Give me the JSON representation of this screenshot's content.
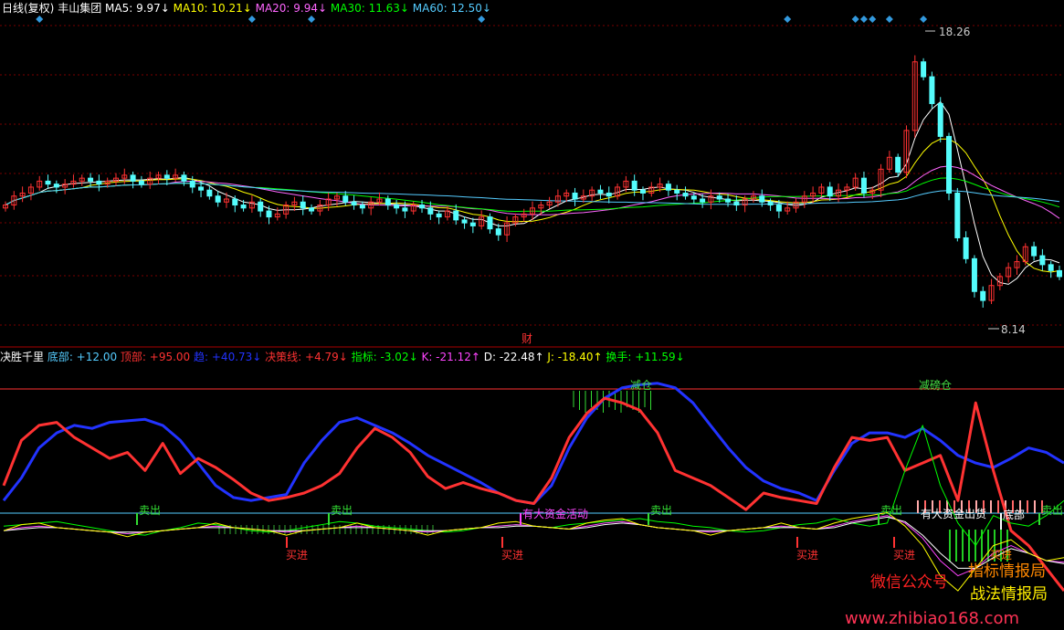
{
  "header_top": {
    "period_label": "日线(复权)",
    "stock_name": "丰山集团",
    "ma": [
      {
        "label": "MA5:",
        "value": "9.97",
        "arrow": "↓",
        "color": "#ffffff"
      },
      {
        "label": "MA10:",
        "value": "10.21",
        "arrow": "↓",
        "color": "#ffff00"
      },
      {
        "label": "MA20:",
        "value": "9.94",
        "arrow": "↓",
        "color": "#ff66ff"
      },
      {
        "label": "MA30:",
        "value": "11.63",
        "arrow": "↓",
        "color": "#00ff00"
      },
      {
        "label": "MA60:",
        "value": "12.50",
        "arrow": "↓",
        "color": "#55ccff"
      }
    ]
  },
  "price_panel": {
    "high_label": "18.26",
    "low_label": "8.14",
    "finance_marker": "财",
    "colors": {
      "up": "#ff3232",
      "down": "#54fcfc",
      "grid": "#7a0000"
    }
  },
  "header_bottom": {
    "indicator_name": "决胜千里",
    "items": [
      {
        "label": "底部:",
        "value": "+12.00",
        "arrow": "",
        "color": "#55ccff"
      },
      {
        "label": "顶部:",
        "value": "+95.00",
        "arrow": "",
        "color": "#ff3232"
      },
      {
        "label": "趋:",
        "value": "+40.73",
        "arrow": "↓",
        "color": "#2233ff"
      },
      {
        "label": "决策线:",
        "value": "+4.79",
        "arrow": "↓",
        "color": "#ff3232"
      },
      {
        "label": "指标:",
        "value": "-3.02",
        "arrow": "↓",
        "color": "#00ff00"
      },
      {
        "label": "K:",
        "value": "-21.12",
        "arrow": "↑",
        "color": "#ff44ff"
      },
      {
        "label": "D:",
        "value": "-22.48",
        "arrow": "↑",
        "color": "#ffffff"
      },
      {
        "label": "J:",
        "value": "-18.40",
        "arrow": "↑",
        "color": "#ffff00"
      },
      {
        "label": "换手:",
        "value": "+11.59",
        "arrow": "↓",
        "color": "#00ff00"
      }
    ]
  },
  "indicator_annotations": {
    "sell": "卖出",
    "buy": "买进",
    "reduce": "减仓",
    "reduce2": "减磅仓",
    "funds_active": "有大资金活动",
    "inflow": "有大资金出货",
    "bottom": "底部",
    "buy_cn": "买进"
  },
  "watermark": {
    "wechat": "微信公众号",
    "name1": "指标情报局",
    "name2": "战法情报局",
    "url": "www.zhibiao168.com"
  },
  "chart_data": [
    {
      "type": "candlestick",
      "title": "丰山集团 日线(复权)",
      "ylim": [
        8,
        18.5
      ],
      "max_price": 18.26,
      "min_price": 8.14,
      "ma_last": {
        "MA5": 9.97,
        "MA10": 10.21,
        "MA20": 9.94,
        "MA30": 11.63,
        "MA60": 12.5
      },
      "close_series": [
        12.3,
        12.6,
        12.7,
        12.9,
        13.1,
        13.0,
        12.9,
        13.0,
        13.1,
        13.2,
        13.1,
        13.0,
        13.1,
        13.2,
        13.3,
        13.1,
        13.0,
        13.2,
        13.3,
        13.2,
        13.3,
        13.1,
        12.9,
        12.8,
        12.6,
        12.4,
        12.5,
        12.3,
        12.2,
        12.4,
        12.1,
        11.9,
        12.0,
        12.3,
        12.4,
        12.2,
        12.1,
        12.3,
        12.5,
        12.6,
        12.4,
        12.3,
        12.2,
        12.4,
        12.5,
        12.3,
        12.2,
        12.1,
        12.3,
        12.2,
        12.0,
        11.9,
        12.1,
        11.8,
        11.7,
        11.6,
        11.9,
        11.5,
        11.3,
        11.7,
        11.9,
        12.0,
        12.2,
        12.3,
        12.4,
        12.6,
        12.7,
        12.5,
        12.6,
        12.8,
        12.7,
        12.6,
        12.9,
        13.1,
        12.8,
        12.7,
        12.9,
        13.0,
        12.8,
        12.7,
        12.6,
        12.5,
        12.4,
        12.6,
        12.5,
        12.4,
        12.3,
        12.5,
        12.6,
        12.4,
        12.3,
        12.1,
        12.2,
        12.4,
        12.6,
        12.7,
        12.9,
        12.6,
        12.8,
        12.9,
        13.2,
        12.7,
        12.8,
        13.5,
        13.9,
        13.4,
        14.8,
        17.1,
        16.6,
        15.7,
        14.6,
        12.7,
        11.2,
        10.5,
        9.4,
        9.1,
        9.6,
        9.9,
        10.2,
        10.4,
        10.9,
        10.6,
        10.3,
        10.1,
        9.9
      ],
      "buy_signal_marks": [
        4,
        29,
        36,
        56,
        92,
        100,
        101,
        102,
        104,
        108
      ]
    },
    {
      "type": "line",
      "title": "决胜千里",
      "ylim": [
        -60,
        110
      ],
      "bottom_line": 12,
      "top_line": 95,
      "series": [
        {
          "name": "趋",
          "color": "#2233ff",
          "values": [
            20,
            35,
            55,
            65,
            70,
            68,
            72,
            73,
            74,
            70,
            60,
            45,
            30,
            22,
            20,
            22,
            24,
            45,
            60,
            72,
            75,
            70,
            65,
            58,
            50,
            44,
            38,
            32,
            25,
            20,
            18,
            30,
            55,
            75,
            88,
            95,
            97,
            98,
            95,
            85,
            70,
            55,
            42,
            33,
            28,
            25,
            20,
            40,
            58,
            65,
            65,
            62,
            68,
            60,
            50,
            45,
            42,
            48,
            55,
            52,
            45
          ]
        },
        {
          "name": "决策线",
          "color": "#ff3232",
          "values": [
            30,
            60,
            70,
            72,
            62,
            55,
            48,
            52,
            40,
            58,
            38,
            48,
            42,
            34,
            25,
            20,
            22,
            25,
            30,
            38,
            55,
            68,
            62,
            52,
            36,
            28,
            32,
            28,
            25,
            20,
            18,
            35,
            62,
            78,
            88,
            85,
            80,
            65,
            40,
            35,
            30,
            22,
            14,
            25,
            22,
            20,
            18,
            42,
            62,
            60,
            62,
            40,
            45,
            50,
            20,
            85,
            40,
            0,
            -10,
            -25,
            -40
          ]
        },
        {
          "name": "指标",
          "color": "#00ff00",
          "values": [
            3,
            4,
            5,
            6,
            4,
            2,
            0,
            -2,
            -3,
            0,
            2,
            5,
            4,
            2,
            0,
            -1,
            0,
            2,
            4,
            6,
            5,
            3,
            2,
            1,
            0,
            -1,
            0,
            2,
            3,
            4,
            3,
            2,
            4,
            5,
            6,
            7,
            8,
            6,
            5,
            3,
            2,
            0,
            -1,
            0,
            2,
            4,
            5,
            8,
            5,
            3,
            5,
            40,
            70,
            30,
            5,
            -10,
            10,
            5,
            3,
            10,
            20
          ]
        },
        {
          "name": "K",
          "color": "#ff44ff",
          "values": [
            0,
            2,
            3,
            2,
            1,
            0,
            -1,
            -2,
            -1,
            0,
            1,
            2,
            3,
            2,
            1,
            0,
            -1,
            0,
            1,
            2,
            3,
            2,
            1,
            0,
            -1,
            0,
            1,
            2,
            3,
            4,
            3,
            2,
            1,
            3,
            5,
            6,
            4,
            2,
            1,
            0,
            -1,
            0,
            1,
            2,
            3,
            2,
            1,
            3,
            6,
            8,
            10,
            5,
            -5,
            -20,
            -30,
            -25,
            -15,
            -10,
            -15,
            -20,
            -21
          ]
        },
        {
          "name": "D",
          "color": "#ffffff",
          "values": [
            0,
            1,
            2,
            2,
            1,
            0,
            -1,
            -1,
            -1,
            0,
            1,
            2,
            2,
            2,
            1,
            0,
            0,
            0,
            1,
            2,
            2,
            2,
            1,
            0,
            0,
            0,
            1,
            2,
            2,
            3,
            3,
            2,
            1,
            2,
            4,
            5,
            4,
            2,
            1,
            0,
            0,
            0,
            1,
            2,
            2,
            2,
            1,
            2,
            5,
            7,
            9,
            6,
            -3,
            -15,
            -25,
            -25,
            -18,
            -12,
            -15,
            -20,
            -22
          ]
        },
        {
          "name": "J",
          "color": "#ffff00",
          "values": [
            0,
            4,
            5,
            2,
            1,
            0,
            -1,
            -4,
            -1,
            0,
            1,
            2,
            5,
            2,
            1,
            0,
            -3,
            0,
            1,
            2,
            5,
            2,
            1,
            0,
            -3,
            0,
            1,
            2,
            5,
            6,
            3,
            2,
            1,
            5,
            7,
            8,
            4,
            2,
            1,
            0,
            -3,
            0,
            1,
            2,
            5,
            2,
            1,
            5,
            8,
            10,
            12,
            3,
            -10,
            -30,
            -40,
            -25,
            -10,
            -6,
            -15,
            -20,
            -18
          ]
        }
      ]
    }
  ]
}
